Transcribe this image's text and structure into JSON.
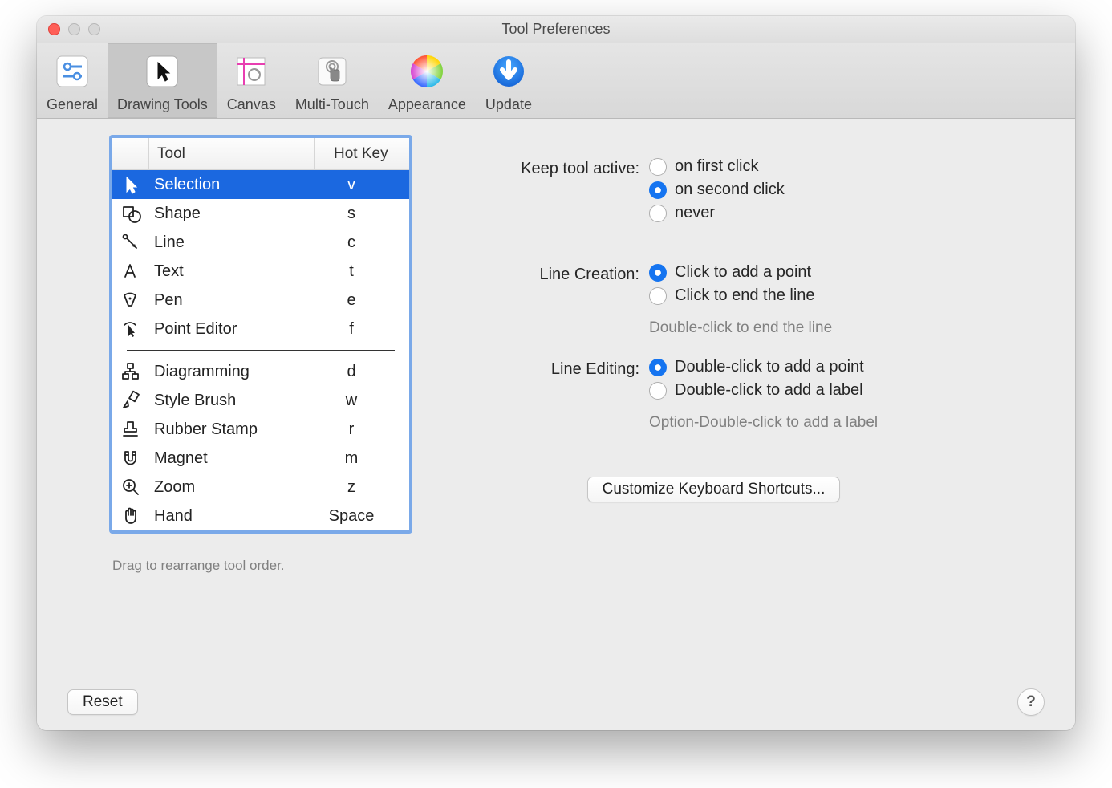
{
  "window": {
    "title": "Tool Preferences"
  },
  "toolbar": {
    "tabs": [
      {
        "label": "General",
        "icon": "sliders-icon"
      },
      {
        "label": "Drawing Tools",
        "icon": "cursor-icon",
        "active": true
      },
      {
        "label": "Canvas",
        "icon": "canvas-icon"
      },
      {
        "label": "Multi-Touch",
        "icon": "touch-icon"
      },
      {
        "label": "Appearance",
        "icon": "color-wheel-icon"
      },
      {
        "label": "Update",
        "icon": "download-arrow-icon"
      }
    ]
  },
  "toolTable": {
    "headers": {
      "tool": "Tool",
      "hotkey": "Hot Key"
    },
    "rowsA": [
      {
        "name": "Selection",
        "hotkey": "v",
        "icon": "cursor-icon",
        "selected": true
      },
      {
        "name": "Shape",
        "hotkey": "s",
        "icon": "shape-icon"
      },
      {
        "name": "Line",
        "hotkey": "c",
        "icon": "line-icon"
      },
      {
        "name": "Text",
        "hotkey": "t",
        "icon": "text-icon"
      },
      {
        "name": "Pen",
        "hotkey": "e",
        "icon": "pen-icon"
      },
      {
        "name": "Point Editor",
        "hotkey": "f",
        "icon": "point-editor-icon"
      }
    ],
    "rowsB": [
      {
        "name": "Diagramming",
        "hotkey": "d",
        "icon": "diagram-icon"
      },
      {
        "name": "Style Brush",
        "hotkey": "w",
        "icon": "brush-icon"
      },
      {
        "name": "Rubber Stamp",
        "hotkey": "r",
        "icon": "stamp-icon"
      },
      {
        "name": "Magnet",
        "hotkey": "m",
        "icon": "magnet-icon"
      },
      {
        "name": "Zoom",
        "hotkey": "z",
        "icon": "zoom-icon"
      },
      {
        "name": "Hand",
        "hotkey": "Space",
        "icon": "hand-icon"
      }
    ],
    "hint": "Drag to rearrange tool order."
  },
  "settings": {
    "keepActive": {
      "label": "Keep tool active:",
      "options": [
        {
          "label": "on first click",
          "checked": false
        },
        {
          "label": "on second click",
          "checked": true
        },
        {
          "label": "never",
          "checked": false
        }
      ]
    },
    "lineCreation": {
      "label": "Line Creation:",
      "options": [
        {
          "label": "Click to add a point",
          "checked": true
        },
        {
          "label": "Click to end the line",
          "checked": false
        }
      ],
      "note": "Double-click to end the line"
    },
    "lineEditing": {
      "label": "Line Editing:",
      "options": [
        {
          "label": "Double-click to add a point",
          "checked": true
        },
        {
          "label": "Double-click to add a label",
          "checked": false
        }
      ],
      "note": "Option-Double-click to add a label"
    },
    "customize": "Customize Keyboard Shortcuts..."
  },
  "footer": {
    "reset": "Reset",
    "help": "?"
  }
}
